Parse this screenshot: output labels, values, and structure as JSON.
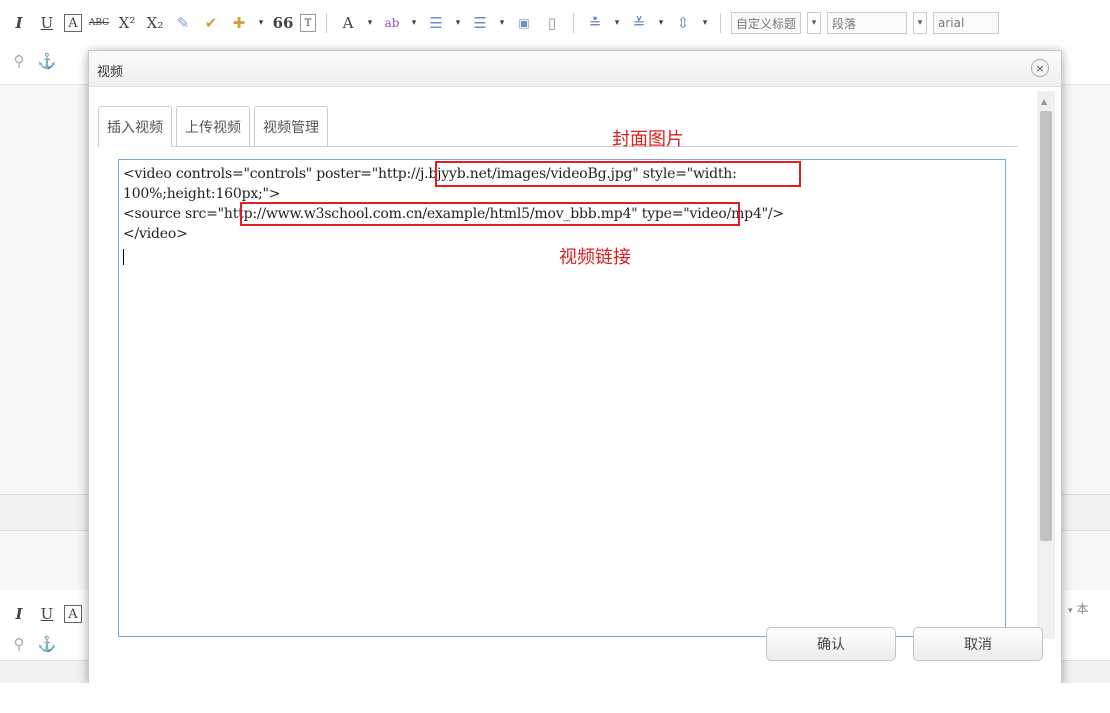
{
  "toolbar": {
    "row1_icons": [
      "I",
      "U",
      "A",
      "ABC",
      "X²",
      "X₂",
      "✎",
      "✔",
      "✚",
      "▾",
      "66",
      "T"
    ],
    "font_color": "A",
    "heading_select": "自定义标题",
    "paragraph_select": "段落",
    "font_select": "arial",
    "row2_icons": [
      "⚲",
      "⚓"
    ],
    "bottom_row_icons": [
      "I",
      "U",
      "A"
    ],
    "right_partial_text": "本"
  },
  "dialog": {
    "title": "视频",
    "close_label": "×",
    "tabs": [
      {
        "label": "插入视频"
      },
      {
        "label": "上传视频"
      },
      {
        "label": "视频管理"
      }
    ],
    "code_lines": [
      "<video controls=\"controls\" poster=\"http://j.bjyyb.net/images/videoBg.jpg\" style=\"width:",
      "100%;height:160px;\">",
      "<source src=\"http://www.w3school.com.cn/example/html5/mov_bbb.mp4\" type=\"video/mp4\"/>",
      "</video>"
    ],
    "annotation_poster": "封面图片",
    "annotation_video_link": "视频链接",
    "confirm_label": "确认",
    "cancel_label": "取消"
  },
  "colors": {
    "annotation_red": "#e02020",
    "editor_focus_border": "#7aa6d6"
  }
}
